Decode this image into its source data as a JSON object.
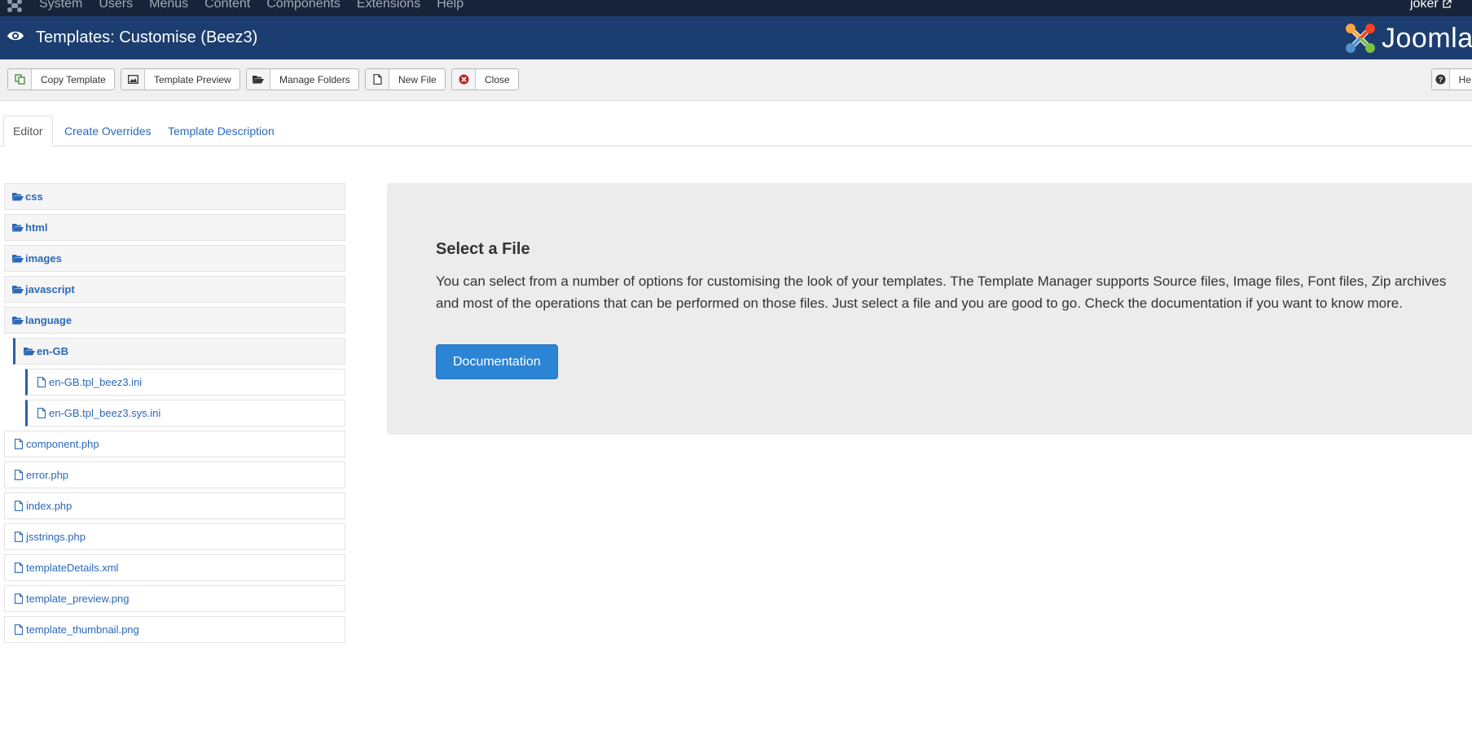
{
  "topnav": {
    "menu": [
      "System",
      "Users",
      "Menus",
      "Content",
      "Components",
      "Extensions",
      "Help"
    ],
    "user": "joker"
  },
  "header": {
    "title": "Templates: Customise (Beez3)",
    "brand": "Joomla"
  },
  "toolbar": {
    "copy_label": "Copy Template",
    "preview_label": "Template Preview",
    "folders_label": "Manage Folders",
    "newfile_label": "New File",
    "close_label": "Close",
    "help_label": "He"
  },
  "tabs": [
    "Editor",
    "Create Overrides",
    "Template Description"
  ],
  "tree": {
    "folders": [
      "css",
      "html",
      "images",
      "javascript",
      "language"
    ],
    "subfolder": "en-GB",
    "subfiles": [
      "en-GB.tpl_beez3.ini",
      "en-GB.tpl_beez3.sys.ini"
    ],
    "files": [
      "component.php",
      "error.php",
      "index.php",
      "jsstrings.php",
      "templateDetails.xml",
      "template_preview.png",
      "template_thumbnail.png"
    ]
  },
  "main": {
    "heading": "Select a File",
    "description": "You can select from a number of options for customising the look of your templates. The Template Manager supports Source files, Image files, Font files, Zip archives and most of the operations that can be performed on those files. Just select a file and you are good to go. Check the documentation if you want to know more.",
    "button_label": "Documentation"
  },
  "colors": {
    "topnav_bg": "#172338",
    "header_bg": "#1b3d6f",
    "link": "#2a69b8",
    "primary_button": "#2b84d4",
    "close_icon": "#c0262d"
  }
}
